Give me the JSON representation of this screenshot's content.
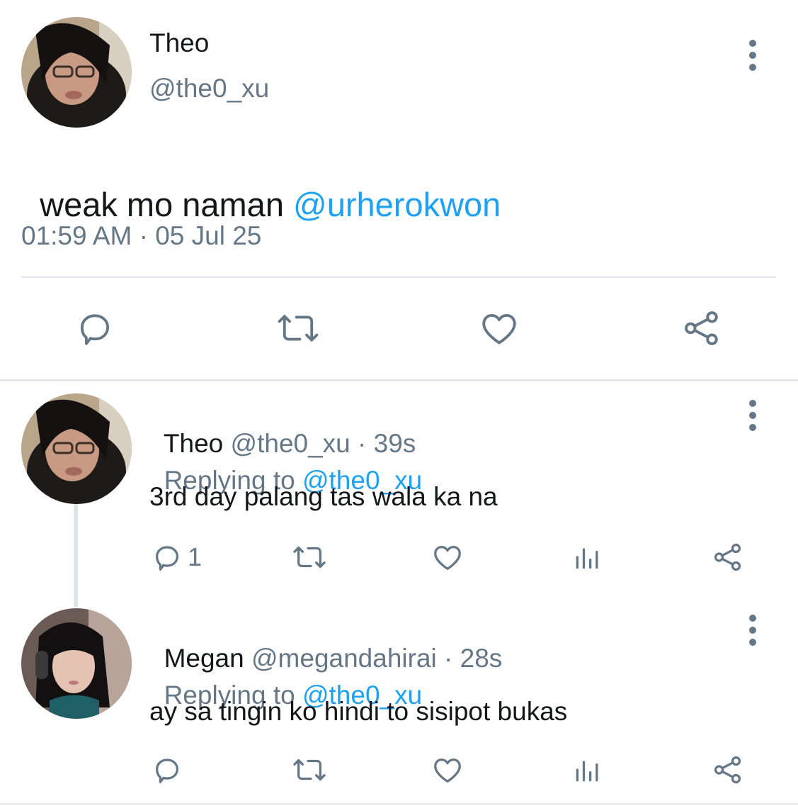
{
  "main_tweet": {
    "name": "Theo",
    "handle": "@the0_xu",
    "text": "weak mo naman ",
    "mention": "@urherokwon",
    "timestamp": "01:59 AM · 05 Jul 25",
    "actions": [
      "reply-icon",
      "retweet-icon",
      "like-icon",
      "share-icon"
    ]
  },
  "replies": [
    {
      "name": "Theo",
      "handle": "@the0_xu",
      "time": "· 39s",
      "replying_prefix": "Replying to ",
      "replying_to": "@the0_xu",
      "text": "3rd day palang tas wala ka na",
      "reply_count": "1"
    },
    {
      "name": "Megan",
      "handle": "@megandahirai",
      "time": "· 28s",
      "replying_prefix": "Replying to ",
      "replying_to": "@the0_xu",
      "text": "ay sa tingin ko hindi to sisipot bukas",
      "reply_count": ""
    }
  ],
  "colors": {
    "text": "#14171a",
    "secondary": "#657786",
    "link": "#1da1f2",
    "divider": "#e1e8ed"
  }
}
